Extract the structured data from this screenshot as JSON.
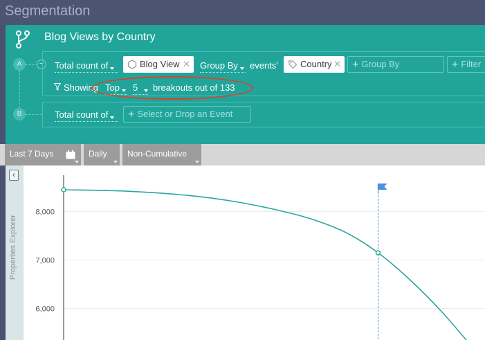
{
  "app": {
    "title": "Segmentation"
  },
  "report": {
    "title": "Blog Views by Country"
  },
  "row_a": {
    "label": "A",
    "metric_label": "Total count of",
    "event_chip": "Blog View",
    "group_by_label": "Group By",
    "events_label": "events'",
    "property_chip": "Country",
    "add_group_by": "Group By",
    "add_filter": "Filter",
    "showing_label": "Showing",
    "top_select": "Top",
    "count_select": "5",
    "breakouts_text": "breakouts out of 133"
  },
  "row_b": {
    "label": "B",
    "metric_label": "Total count of",
    "event_placeholder": "Select or Drop an Event"
  },
  "toolbar": {
    "date_range": "Last 7 Days",
    "interval": "Daily",
    "mode": "Non-Cumulative"
  },
  "sidebar": {
    "label": "Properties Explorer"
  },
  "colors": {
    "panel": "#21a59b",
    "line": "#2aa69c",
    "annotation": "#d8432b",
    "marker_flag": "#4a90e2"
  },
  "chart_data": {
    "type": "line",
    "ylim": [
      5350,
      8950
    ],
    "y_ticks": [
      6000,
      7000,
      8000
    ],
    "y_tick_labels": [
      "8,000",
      "7,000",
      "6,000"
    ],
    "xlim": [
      0,
      1.34
    ],
    "x": [
      0,
      0.2,
      0.4,
      0.55,
      0.7,
      0.8,
      0.9,
      1.0,
      1.1,
      1.2,
      1.3
    ],
    "y": [
      8450,
      8420,
      8330,
      8200,
      8000,
      7820,
      7560,
      7150,
      6600,
      5950,
      5200
    ],
    "points": [
      {
        "x": 0,
        "y": 8450
      },
      {
        "x": 1.0,
        "y": 7150
      }
    ],
    "marker_x": 1.0
  }
}
